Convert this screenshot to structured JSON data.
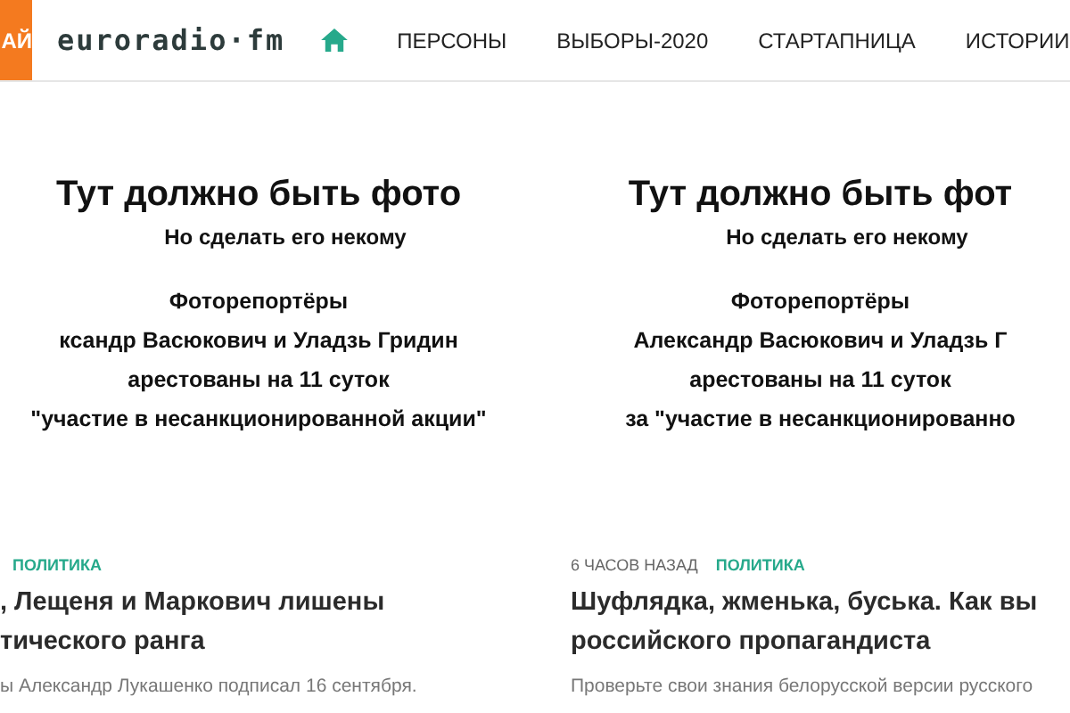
{
  "header": {
    "corner_tab": "АЙ",
    "logo": "euroradio·fm",
    "nav": [
      {
        "kind": "home"
      },
      {
        "kind": "link",
        "label": "ПЕРСОНЫ"
      },
      {
        "kind": "link",
        "label": "ВЫБОРЫ-2020"
      },
      {
        "kind": "link",
        "label": "СТАРТАПНИЦА"
      },
      {
        "kind": "link",
        "label": "ИСТОРИИ"
      }
    ]
  },
  "articles": [
    {
      "image_lines": [
        "Тут должно быть фото",
        "Но сделать его некому",
        "Фоторепортёры",
        "ксандр Васюкович и Уладзь Гридин",
        "арестованы на 11 суток",
        "\"участие в несанкционированной акции\""
      ],
      "category": "ПОЛИТИКА",
      "title": ", Лещеня и Маркович лишены\nтического ранга",
      "excerpt": "ы Александр Лукашенко подписал 16 сентября."
    },
    {
      "image_lines": [
        "Тут должно быть фот",
        "Но сделать его некому",
        "Фоторепортёры",
        "Александр Васюкович и Уладзь Г",
        "арестованы на 11 суток",
        "за \"участие в несанкционированно"
      ],
      "time": "6 ЧАСОВ НАЗАД",
      "category": "ПОЛИТИКА",
      "title": "Шуфлядка, жменька, буська. Как вы\nроссийского пропагандиста",
      "excerpt": "Проверьте свои знания белорусской версии русского"
    }
  ]
}
